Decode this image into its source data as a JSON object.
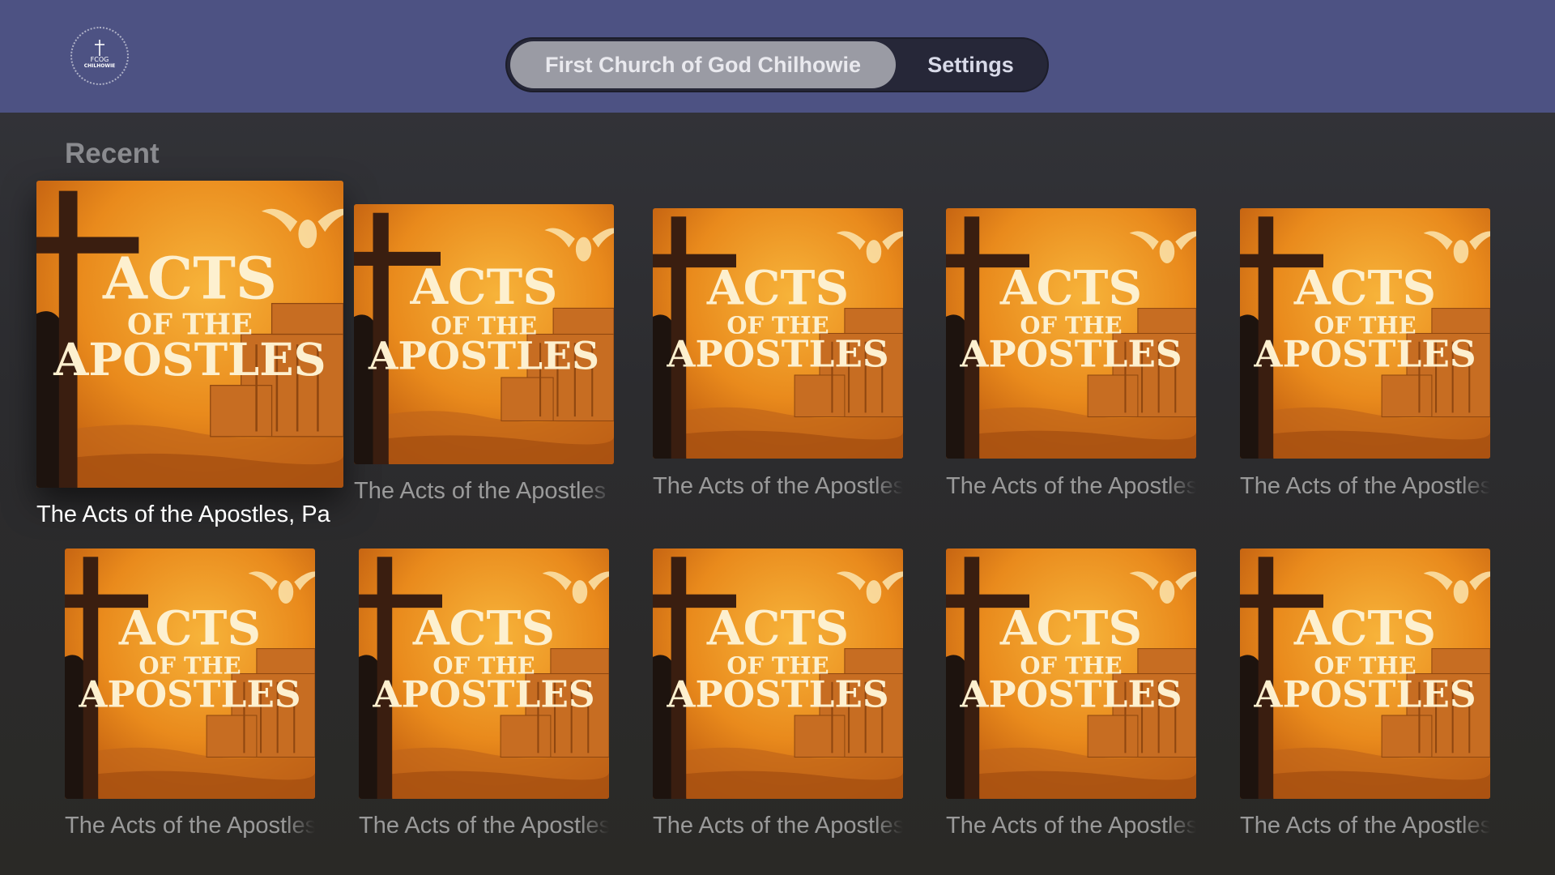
{
  "header": {
    "logo_text_line1": "FCOG",
    "logo_text_line2": "CHILHOWIE",
    "tabs": [
      {
        "label": "First Church of God Chilhowie",
        "selected": true
      },
      {
        "label": "Settings",
        "selected": false
      }
    ],
    "colors": {
      "bar": "#4d5283",
      "tab_selected": "#9a9ba4"
    }
  },
  "section": {
    "title": "Recent"
  },
  "artwork": {
    "line1": "ACTS",
    "line2": "OF THE",
    "line3": "APOSTLES",
    "icon": "cross-dove-temple-artwork"
  },
  "tiles": [
    {
      "label": "The Acts of the Apostles, Pa",
      "focused": true
    },
    {
      "label": "The Acts of the Apostles"
    },
    {
      "label": "The Acts of the Apostles"
    },
    {
      "label": "The Acts of the Apostles"
    },
    {
      "label": "The Acts of the Apostles"
    },
    {
      "label": "The Acts of the Apostles"
    },
    {
      "label": "The Acts of the Apostles"
    },
    {
      "label": "The Acts of the Apostles"
    },
    {
      "label": "The Acts of the Apostles"
    },
    {
      "label": "The Acts of the Apostles"
    }
  ]
}
